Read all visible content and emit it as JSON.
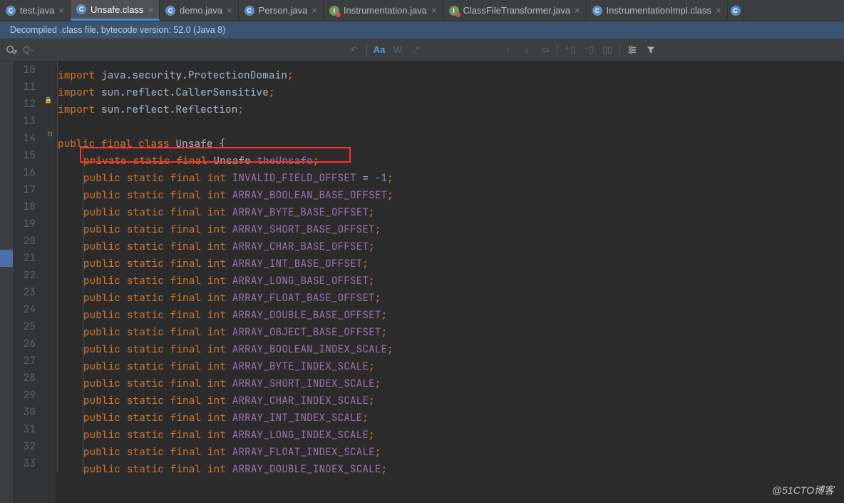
{
  "tabs": [
    {
      "label": "test.java",
      "icon": "C"
    },
    {
      "label": "Unsafe.class",
      "icon": "C",
      "active": true
    },
    {
      "label": "demo.java",
      "icon": "C"
    },
    {
      "label": "Person.java",
      "icon": "C"
    },
    {
      "label": "Instrumentation.java",
      "icon": "I"
    },
    {
      "label": "ClassFileTransformer.java",
      "icon": "I"
    },
    {
      "label": "InstrumentationImpl.class",
      "icon": "C"
    }
  ],
  "banner": "Decompiled .class file, bytecode version: 52.0 (Java 8)",
  "find": {
    "placeholder": "Q-",
    "aa": "Aa",
    "w": "W",
    "sym": ".*"
  },
  "lines": {
    "start": 10,
    "rows": [
      {
        "n": 10,
        "indent": 1,
        "t": [
          [
            "kw",
            "import"
          ],
          [
            "id",
            " java.security.ProtectionDomain"
          ],
          [
            "punct",
            ";"
          ]
        ]
      },
      {
        "n": 11,
        "indent": 1,
        "t": [
          [
            "kw",
            "import"
          ],
          [
            "id",
            " sun.reflect.CallerSensitive"
          ],
          [
            "punct",
            ";"
          ]
        ]
      },
      {
        "n": 12,
        "indent": 1,
        "t": [
          [
            "kw",
            "import"
          ],
          [
            "id",
            " sun.reflect.Reflection"
          ],
          [
            "punct",
            ";"
          ]
        ],
        "lock": true
      },
      {
        "n": 13,
        "indent": 1,
        "t": []
      },
      {
        "n": 14,
        "indent": 1,
        "t": [
          [
            "kw",
            "public final class"
          ],
          [
            "id",
            " Unsafe {"
          ]
        ]
      },
      {
        "n": 15,
        "indent": 2,
        "boxed": true,
        "t": [
          [
            "kw",
            "private static final"
          ],
          [
            "id",
            " Unsafe "
          ],
          [
            "field",
            "theUnsafe"
          ],
          [
            "punct",
            ";"
          ]
        ]
      },
      {
        "n": 16,
        "indent": 2,
        "t": [
          [
            "kw",
            "public static final int"
          ],
          [
            "id",
            " "
          ],
          [
            "field",
            "INVALID_FIELD_OFFSET"
          ],
          [
            "id",
            " = "
          ],
          [
            "num",
            "-1"
          ],
          [
            "punct",
            ";"
          ]
        ]
      },
      {
        "n": 17,
        "indent": 2,
        "t": [
          [
            "kw",
            "public static final int"
          ],
          [
            "id",
            " "
          ],
          [
            "field",
            "ARRAY_BOOLEAN_BASE_OFFSET"
          ],
          [
            "punct",
            ";"
          ]
        ]
      },
      {
        "n": 18,
        "indent": 2,
        "t": [
          [
            "kw",
            "public static final int"
          ],
          [
            "id",
            " "
          ],
          [
            "field",
            "ARRAY_BYTE_BASE_OFFSET"
          ],
          [
            "punct",
            ";"
          ]
        ]
      },
      {
        "n": 19,
        "indent": 2,
        "t": [
          [
            "kw",
            "public static final int"
          ],
          [
            "id",
            " "
          ],
          [
            "field",
            "ARRAY_SHORT_BASE_OFFSET"
          ],
          [
            "punct",
            ";"
          ]
        ]
      },
      {
        "n": 20,
        "indent": 2,
        "t": [
          [
            "kw",
            "public static final int"
          ],
          [
            "id",
            " "
          ],
          [
            "field",
            "ARRAY_CHAR_BASE_OFFSET"
          ],
          [
            "punct",
            ";"
          ]
        ]
      },
      {
        "n": 21,
        "indent": 2,
        "t": [
          [
            "kw",
            "public static final int"
          ],
          [
            "id",
            " "
          ],
          [
            "field",
            "ARRAY_INT_BASE_OFFSET"
          ],
          [
            "punct",
            ";"
          ]
        ]
      },
      {
        "n": 22,
        "indent": 2,
        "t": [
          [
            "kw",
            "public static final int"
          ],
          [
            "id",
            " "
          ],
          [
            "field",
            "ARRAY_LONG_BASE_OFFSET"
          ],
          [
            "punct",
            ";"
          ]
        ]
      },
      {
        "n": 23,
        "indent": 2,
        "t": [
          [
            "kw",
            "public static final int"
          ],
          [
            "id",
            " "
          ],
          [
            "field",
            "ARRAY_FLOAT_BASE_OFFSET"
          ],
          [
            "punct",
            ";"
          ]
        ]
      },
      {
        "n": 24,
        "indent": 2,
        "t": [
          [
            "kw",
            "public static final int"
          ],
          [
            "id",
            " "
          ],
          [
            "field",
            "ARRAY_DOUBLE_BASE_OFFSET"
          ],
          [
            "punct",
            ";"
          ]
        ]
      },
      {
        "n": 25,
        "indent": 2,
        "t": [
          [
            "kw",
            "public static final int"
          ],
          [
            "id",
            " "
          ],
          [
            "field",
            "ARRAY_OBJECT_BASE_OFFSET"
          ],
          [
            "punct",
            ";"
          ]
        ]
      },
      {
        "n": 26,
        "indent": 2,
        "t": [
          [
            "kw",
            "public static final int"
          ],
          [
            "id",
            " "
          ],
          [
            "field",
            "ARRAY_BOOLEAN_INDEX_SCALE"
          ],
          [
            "punct",
            ";"
          ]
        ]
      },
      {
        "n": 27,
        "indent": 2,
        "t": [
          [
            "kw",
            "public static final int"
          ],
          [
            "id",
            " "
          ],
          [
            "field",
            "ARRAY_BYTE_INDEX_SCALE"
          ],
          [
            "punct",
            ";"
          ]
        ]
      },
      {
        "n": 28,
        "indent": 2,
        "t": [
          [
            "kw",
            "public static final int"
          ],
          [
            "id",
            " "
          ],
          [
            "field",
            "ARRAY_SHORT_INDEX_SCALE"
          ],
          [
            "punct",
            ";"
          ]
        ]
      },
      {
        "n": 29,
        "indent": 2,
        "t": [
          [
            "kw",
            "public static final int"
          ],
          [
            "id",
            " "
          ],
          [
            "field",
            "ARRAY_CHAR_INDEX_SCALE"
          ],
          [
            "punct",
            ";"
          ]
        ]
      },
      {
        "n": 30,
        "indent": 2,
        "t": [
          [
            "kw",
            "public static final int"
          ],
          [
            "id",
            " "
          ],
          [
            "field",
            "ARRAY_INT_INDEX_SCALE"
          ],
          [
            "punct",
            ";"
          ]
        ]
      },
      {
        "n": 31,
        "indent": 2,
        "t": [
          [
            "kw",
            "public static final int"
          ],
          [
            "id",
            " "
          ],
          [
            "field",
            "ARRAY_LONG_INDEX_SCALE"
          ],
          [
            "punct",
            ";"
          ]
        ]
      },
      {
        "n": 32,
        "indent": 2,
        "t": [
          [
            "kw",
            "public static final int"
          ],
          [
            "id",
            " "
          ],
          [
            "field",
            "ARRAY_FLOAT_INDEX_SCALE"
          ],
          [
            "punct",
            ";"
          ]
        ]
      },
      {
        "n": 33,
        "indent": 2,
        "t": [
          [
            "kw",
            "public static final int"
          ],
          [
            "id",
            " "
          ],
          [
            "field",
            "ARRAY_DOUBLE_INDEX_SCALE"
          ],
          [
            "punct",
            ";"
          ]
        ]
      }
    ]
  },
  "watermark": "@51CTO博客"
}
